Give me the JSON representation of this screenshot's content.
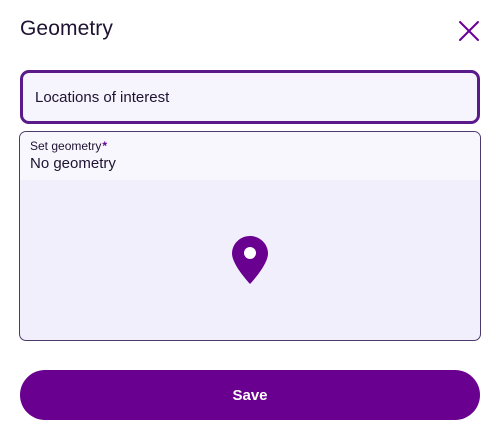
{
  "dialog": {
    "title": "Geometry",
    "close_icon": "close-icon"
  },
  "name_field": {
    "value": "Locations of interest"
  },
  "geometry_field": {
    "label": "Set geometry",
    "required_marker": "*",
    "value": "No geometry",
    "icon": "map-pin-icon"
  },
  "actions": {
    "save_label": "Save"
  },
  "colors": {
    "accent": "#69008f",
    "input_border": "#5b1a8a",
    "field_background": "#f2effc",
    "text": "#1f1233"
  }
}
